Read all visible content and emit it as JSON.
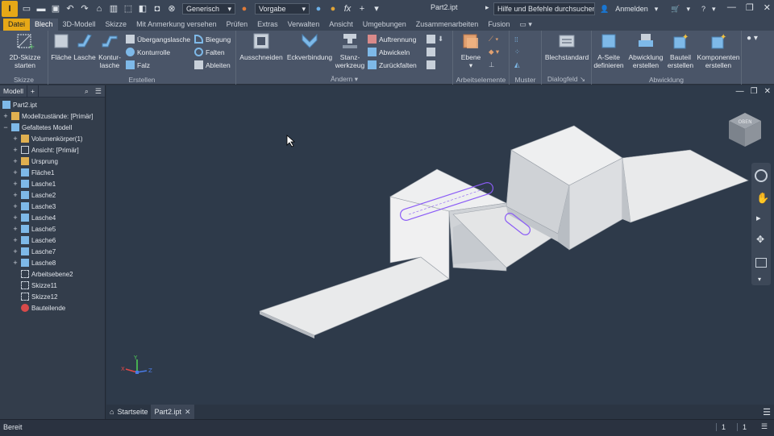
{
  "titlebar": {
    "logo": "I",
    "appearance_preset": "Generisch",
    "material_preset": "Vorgabe",
    "filename": "Part2.ipt",
    "search_placeholder": "Hilfe und Befehle durchsuchen...",
    "signin_label": "Anmelden"
  },
  "tabs": [
    "Datei",
    "Blech",
    "3D-Modell",
    "Skizze",
    "Mit Anmerkung versehen",
    "Prüfen",
    "Extras",
    "Verwalten",
    "Ansicht",
    "Umgebungen",
    "Zusammenarbeiten",
    "Fusion"
  ],
  "ribbon": {
    "skizze": {
      "title": "Skizze",
      "start_sketch_line1": "2D-Skizze",
      "start_sketch_line2": "starten"
    },
    "erstellen": {
      "title": "Erstellen",
      "flaeche": "Fläche",
      "lasche": "Lasche",
      "konturlasche_line1": "Kontur-",
      "konturlasche_line2": "lasche",
      "uebergangslasche": "Übergangslasche",
      "konturrolle": "Konturrolle",
      "falz": "Falz",
      "biegung": "Biegung",
      "falten": "Falten",
      "ableiten": "Ableiten"
    },
    "aendern": {
      "title": "Ändern",
      "ausschneiden": "Ausschneiden",
      "eckverbindung": "Eckverbindung",
      "stanz_line1": "Stanz-",
      "stanz_line2": "werkzeug",
      "auftrennung": "Auftrennung",
      "abwickeln": "Abwickeln",
      "zurueckfalten": "Zurückfalten"
    },
    "arbeitselemente": {
      "title": "Arbeitselemente",
      "ebene": "Ebene"
    },
    "muster": {
      "title": "Muster"
    },
    "dialogfeld": {
      "title": "Dialogfeld",
      "blechstandard": "Blechstandard"
    },
    "abwicklung": {
      "title": "Abwicklung",
      "aseite_line1": "A-Seite",
      "aseite_line2": "definieren",
      "abw_line1": "Abwicklung",
      "abw_line2": "erstellen",
      "bauteil_line1": "Bauteil",
      "bauteil_line2": "erstellen",
      "komp_line1": "Komponenten",
      "komp_line2": "erstellen"
    }
  },
  "browser": {
    "tab_label": "Modell",
    "tree": [
      "Part2.ipt",
      "Modellzustände: [Primär]",
      "Gefaltetes Modell",
      "Volumenkörper(1)",
      "Ansicht: [Primär]",
      "Ursprung",
      "Fläche1",
      "Lasche1",
      "Lasche2",
      "Lasche3",
      "Lasche4",
      "Lasche5",
      "Lasche6",
      "Lasche7",
      "Lasche8",
      "Arbeitsebene2",
      "Skizze11",
      "Skizze12",
      "Bauteilende"
    ]
  },
  "viewcube": {
    "face_label": "OBEN"
  },
  "triad": {
    "x": "X",
    "y": "Y",
    "z": "Z"
  },
  "doctabs": {
    "home": "Startseite",
    "doc": "Part2.ipt"
  },
  "status": {
    "text": "Bereit",
    "n1": "1",
    "n2": "1"
  },
  "colors": {
    "accent": "#e6a817",
    "sketch": "#8b5cf6",
    "background": "#2e3a4a"
  }
}
